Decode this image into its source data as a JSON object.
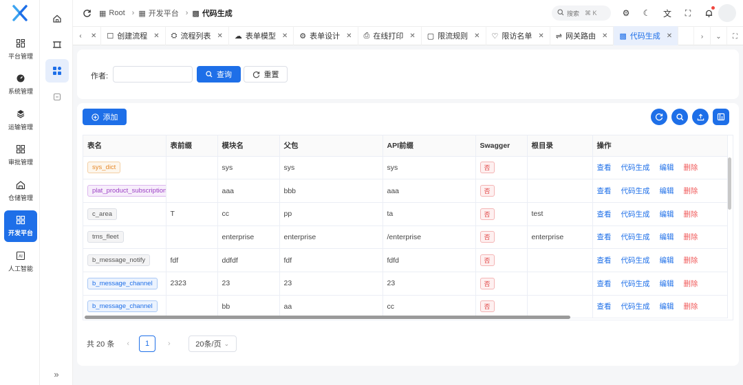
{
  "nav": {
    "items": [
      {
        "label": "平台管理",
        "icon": "platform-icon"
      },
      {
        "label": "系统管理",
        "icon": "dashboard-icon"
      },
      {
        "label": "运输管理",
        "icon": "transport-icon"
      },
      {
        "label": "审批管理",
        "icon": "approval-icon"
      },
      {
        "label": "仓储管理",
        "icon": "warehouse-icon"
      },
      {
        "label": "开发平台",
        "icon": "dev-icon",
        "active": true
      },
      {
        "label": "人工智能",
        "icon": "ai-icon"
      }
    ]
  },
  "header": {
    "breadcrumb": [
      "Root",
      "开发平台",
      "代码生成"
    ],
    "search_label": "搜索",
    "search_shortcut": "⌘ K"
  },
  "tabs": [
    {
      "label": "创建流程"
    },
    {
      "label": "流程列表"
    },
    {
      "label": "表单模型"
    },
    {
      "label": "表单设计"
    },
    {
      "label": "在线打印"
    },
    {
      "label": "限流规则"
    },
    {
      "label": "限访名单"
    },
    {
      "label": "网关路由"
    },
    {
      "label": "代码生成",
      "active": true
    }
  ],
  "search_form": {
    "author_label": "作者:",
    "author_value": "",
    "query_label": "查询",
    "reset_label": "重置"
  },
  "toolbar": {
    "add_label": "添加"
  },
  "table": {
    "columns": [
      "表名",
      "表前缀",
      "模块名",
      "父包",
      "API前缀",
      "Swagger",
      "根目录",
      "操作"
    ],
    "actions": [
      "查看",
      "代码生成",
      "编辑",
      "删除"
    ],
    "rows": [
      {
        "name": "sys_dict",
        "tag_color": "orange",
        "prefix": "",
        "module": "sys",
        "package": "sys",
        "api": "sys",
        "swagger": "否",
        "root": ""
      },
      {
        "name": "plat_product_subscription",
        "tag_color": "purple",
        "prefix": "",
        "module": "aaa",
        "package": "bbb",
        "api": "aaa",
        "swagger": "否",
        "root": ""
      },
      {
        "name": "c_area",
        "tag_color": "gray",
        "prefix": "T",
        "module": "cc",
        "package": "pp",
        "api": "ta",
        "swagger": "否",
        "root": "test"
      },
      {
        "name": "tms_fleet",
        "tag_color": "gray",
        "prefix": "",
        "module": "enterprise",
        "package": "enterprise",
        "api": "/enterprise",
        "swagger": "否",
        "root": "enterprise"
      },
      {
        "name": "b_message_notify",
        "tag_color": "gray",
        "prefix": "fdf",
        "module": "ddfdf",
        "package": "fdf",
        "api": "fdfd",
        "swagger": "否",
        "root": ""
      },
      {
        "name": "b_message_channel",
        "tag_color": "blue",
        "prefix": "2323",
        "module": "23",
        "package": "23",
        "api": "23",
        "swagger": "否",
        "root": ""
      },
      {
        "name": "b_message_channel",
        "tag_color": "blue",
        "prefix": "",
        "module": "bb",
        "package": "aa",
        "api": "cc",
        "swagger": "否",
        "root": ""
      }
    ]
  },
  "pagination": {
    "total_text": "共 20 条",
    "current_page": "1",
    "page_size": "20条/页"
  }
}
